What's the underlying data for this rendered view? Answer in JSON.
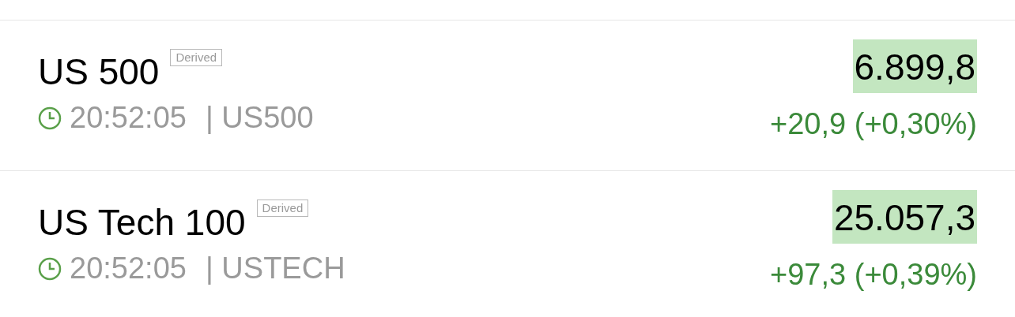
{
  "quotes": [
    {
      "name": "US 500",
      "badge": "Derived",
      "price": "6.899,8",
      "price_rising": true,
      "time": "20:52:05",
      "symbol": "| US500",
      "change": "+20,9 (+0,30%)",
      "change_positive": true
    },
    {
      "name": "US Tech 100",
      "badge": "Derived",
      "price": "25.057,3",
      "price_rising": true,
      "time": "20:52:05",
      "symbol": "| USTECH",
      "change": "+97,3 (+0,39%)",
      "change_positive": true
    }
  ]
}
